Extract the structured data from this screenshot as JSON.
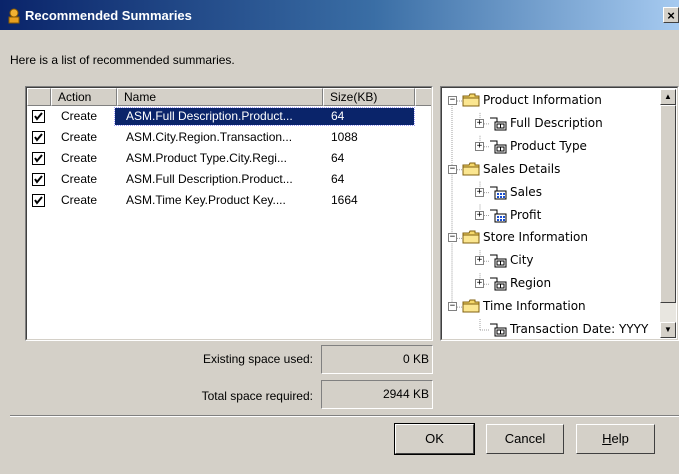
{
  "window": {
    "title": "Recommended Summaries",
    "close_label": "×"
  },
  "intro_text": "Here is a list of recommended summaries.",
  "list": {
    "columns": [
      "Action",
      "Name",
      "Size(KB)"
    ],
    "rows": [
      {
        "checked": true,
        "action": "Create",
        "name": "ASM.Full Description.Product...",
        "size": "64",
        "selected": true
      },
      {
        "checked": true,
        "action": "Create",
        "name": "ASM.City.Region.Transaction...",
        "size": "1088",
        "selected": false
      },
      {
        "checked": true,
        "action": "Create",
        "name": "ASM.Product Type.City.Regi...",
        "size": "64",
        "selected": false
      },
      {
        "checked": true,
        "action": "Create",
        "name": "ASM.Full Description.Product...",
        "size": "64",
        "selected": false
      },
      {
        "checked": true,
        "action": "Create",
        "name": "ASM.Time Key.Product Key....",
        "size": "1664",
        "selected": false
      }
    ]
  },
  "tree": {
    "nodes": [
      {
        "label": "Product Information",
        "level": 0,
        "expander": "−",
        "icon": "folder-icon"
      },
      {
        "label": "Full Description",
        "level": 1,
        "expander": "+",
        "icon": "dimension-icon"
      },
      {
        "label": "Product Type",
        "level": 1,
        "expander": "+",
        "icon": "dimension-icon"
      },
      {
        "label": "Sales Details",
        "level": 0,
        "expander": "−",
        "icon": "folder-icon"
      },
      {
        "label": "Sales",
        "level": 1,
        "expander": "+",
        "icon": "measure-icon"
      },
      {
        "label": "Profit",
        "level": 1,
        "expander": "+",
        "icon": "measure-icon"
      },
      {
        "label": "Store Information",
        "level": 0,
        "expander": "−",
        "icon": "folder-icon"
      },
      {
        "label": "City",
        "level": 1,
        "expander": "+",
        "icon": "dimension-icon"
      },
      {
        "label": "Region",
        "level": 1,
        "expander": "+",
        "icon": "dimension-icon"
      },
      {
        "label": "Time Information",
        "level": 0,
        "expander": "−",
        "icon": "folder-icon"
      },
      {
        "label": "Transaction Date: YYYY",
        "level": 1,
        "expander": "",
        "icon": "dimension-icon"
      }
    ]
  },
  "existing_space": {
    "label": "Existing space used:",
    "value": "0 KB"
  },
  "total_space": {
    "label": "Total space required:",
    "value": "2944 KB"
  },
  "buttons": {
    "ok": "OK",
    "cancel": "Cancel",
    "help": "Help"
  },
  "colors": {
    "titlebar_start": "#0a246a",
    "selection": "#0a246a",
    "folder": "#f6d86a"
  }
}
